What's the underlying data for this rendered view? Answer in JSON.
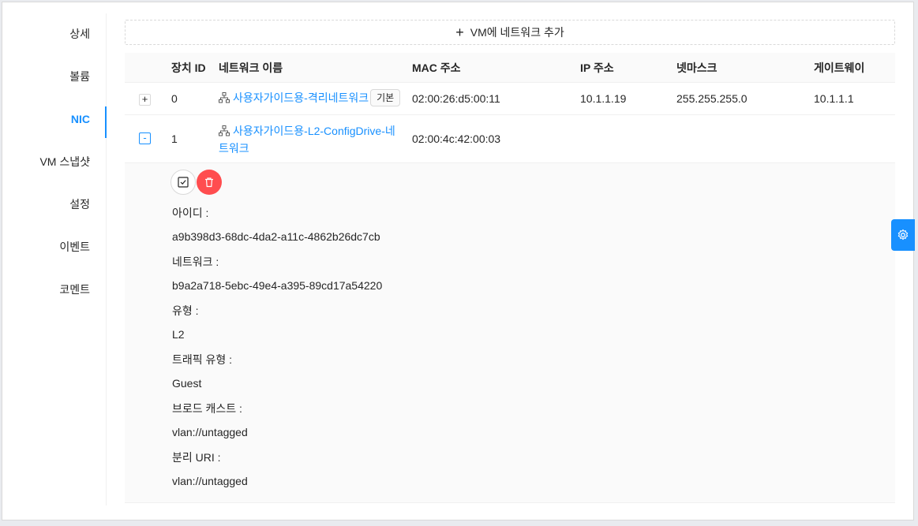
{
  "tabs": [
    {
      "label": "상세"
    },
    {
      "label": "볼륨"
    },
    {
      "label": "NIC"
    },
    {
      "label": "VM 스냅샷"
    },
    {
      "label": "설정"
    },
    {
      "label": "이벤트"
    },
    {
      "label": "코멘트"
    }
  ],
  "active_tab": "NIC",
  "add_button": {
    "label": "VM에 네트워크 추가"
  },
  "table": {
    "headers": [
      "장치 ID",
      "네트워크 이름",
      "MAC 주소",
      "IP 주소",
      "넷마스크",
      "게이트웨이"
    ],
    "rows": [
      {
        "expand": "+",
        "device_id": "0",
        "network_name": "사용자가이드용-격리네트워크",
        "tag": "기본",
        "mac": "02:00:26:d5:00:11",
        "ip": "10.1.1.19",
        "netmask": "255.255.255.0",
        "gateway": "10.1.1.1"
      },
      {
        "expand": "-",
        "device_id": "1",
        "network_name_line1": "사용자가이드용-L2-ConfigDrive-네",
        "network_name_line2": "트워크",
        "mac": "02:00:4c:42:00:03",
        "ip": "",
        "netmask": "",
        "gateway": ""
      }
    ]
  },
  "details": {
    "id_label": "아이디 :",
    "id_value": "a9b398d3-68dc-4da2-a11c-4862b26dc7cb",
    "network_label": "네트워크 :",
    "network_value": "b9a2a718-5ebc-49e4-a395-89cd17a54220",
    "type_label": "유형 :",
    "type_value": "L2",
    "traffic_label": "트래픽 유형 :",
    "traffic_value": "Guest",
    "broadcast_label": "브로드 캐스트 :",
    "broadcast_value": "vlan://untagged",
    "isolation_label": "분리 URI :",
    "isolation_value": "vlan://untagged"
  },
  "colors": {
    "accent": "#1890ff",
    "danger": "#ff4d4f"
  },
  "icons": [
    "plus-icon",
    "network-icon",
    "check-square-icon",
    "delete-icon",
    "gear-icon"
  ]
}
